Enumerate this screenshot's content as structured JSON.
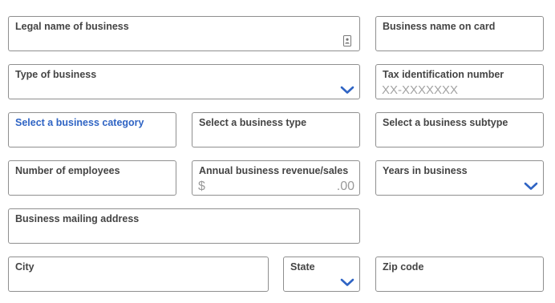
{
  "form": {
    "legal_name": {
      "label": "Legal name of business",
      "icon": "contact-card-icon"
    },
    "name_on_card": {
      "label": "Business name on card"
    },
    "type_of_business": {
      "label": "Type of business",
      "icon": "chevron-down-icon"
    },
    "tax_id": {
      "label": "Tax identification number",
      "placeholder": "XX-XXXXXXX"
    },
    "business_category": {
      "label": "Select a business category"
    },
    "business_type": {
      "label": "Select a business type"
    },
    "business_subtype": {
      "label": "Select a business subtype"
    },
    "employees": {
      "label": "Number of employees"
    },
    "annual_revenue": {
      "label": "Annual business revenue/sales",
      "currency_symbol": "$",
      "cents": ".00"
    },
    "years_in_business": {
      "label": "Years in business",
      "icon": "chevron-down-icon"
    },
    "mailing_address": {
      "label": "Business mailing address"
    },
    "city": {
      "label": "City"
    },
    "state": {
      "label": "State",
      "icon": "chevron-down-icon"
    },
    "zip_code": {
      "label": "Zip code"
    }
  },
  "colors": {
    "border": "#8f8f8f",
    "label": "#444444",
    "accent": "#2f64c4",
    "placeholder": "#a3a3a3"
  }
}
